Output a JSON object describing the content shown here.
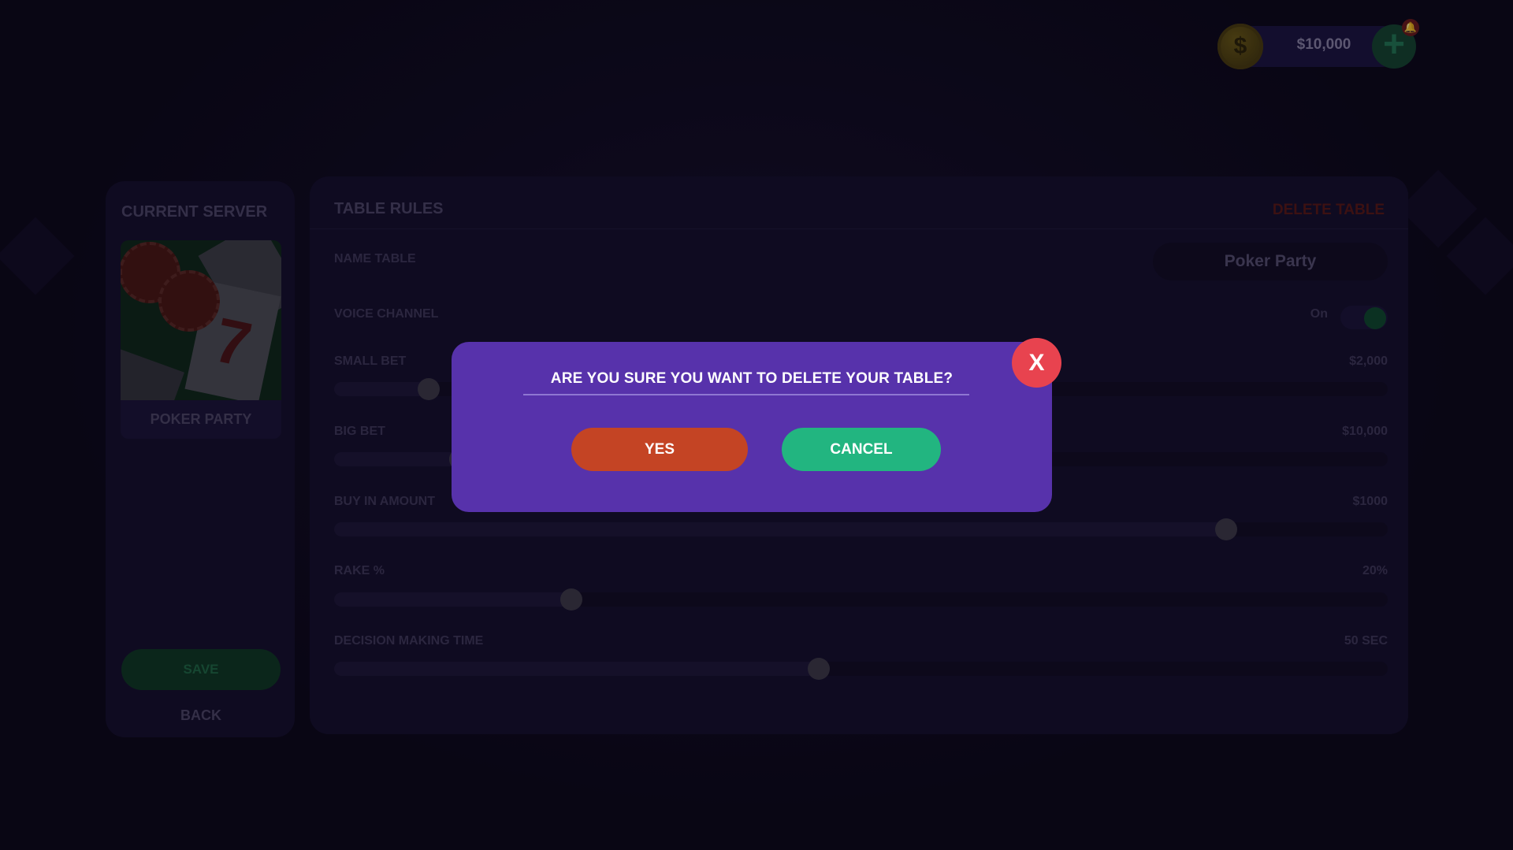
{
  "topbar": {
    "coin_symbol": "$",
    "balance": "$10,000",
    "add_symbol": "+",
    "notification_symbol": "🔔"
  },
  "left_panel": {
    "title": "CURRENT SERVER",
    "server_name": "POKER PARTY",
    "card_rank": "7",
    "save_label": "SAVE",
    "back_label": "BACK"
  },
  "table_rules": {
    "title": "TABLE RULES",
    "delete_label": "DELETE TABLE",
    "name_table": {
      "label": "NAME TABLE",
      "value": "Poker Party"
    },
    "voice_channel": {
      "label": "VOICE CHANNEL",
      "state": "On"
    },
    "small_bet": {
      "label": "SMALL BET",
      "value": "$2,000",
      "level": 0.09
    },
    "big_bet": {
      "label": "BIG BET",
      "value": "$10,000",
      "level": 0.12
    },
    "buy_in": {
      "label": "BUY IN AMOUNT",
      "value": "$1000",
      "level": 0.847
    },
    "rake": {
      "label": "RAKE %",
      "value": "20%",
      "level": 0.225
    },
    "decision_time": {
      "label": "DECISION MAKING TIME",
      "value": "50 SEC",
      "level": 0.46
    }
  },
  "dialog": {
    "title": "ARE YOU SURE YOU WANT TO DELETE YOUR TABLE?",
    "yes_label": "YES",
    "cancel_label": "CANCEL",
    "close_label": "X"
  },
  "colors": {
    "dialog_bg": "#5732ab",
    "yes_button": "#c44424",
    "cancel_button": "#22b580",
    "close_button": "#e8434f"
  }
}
